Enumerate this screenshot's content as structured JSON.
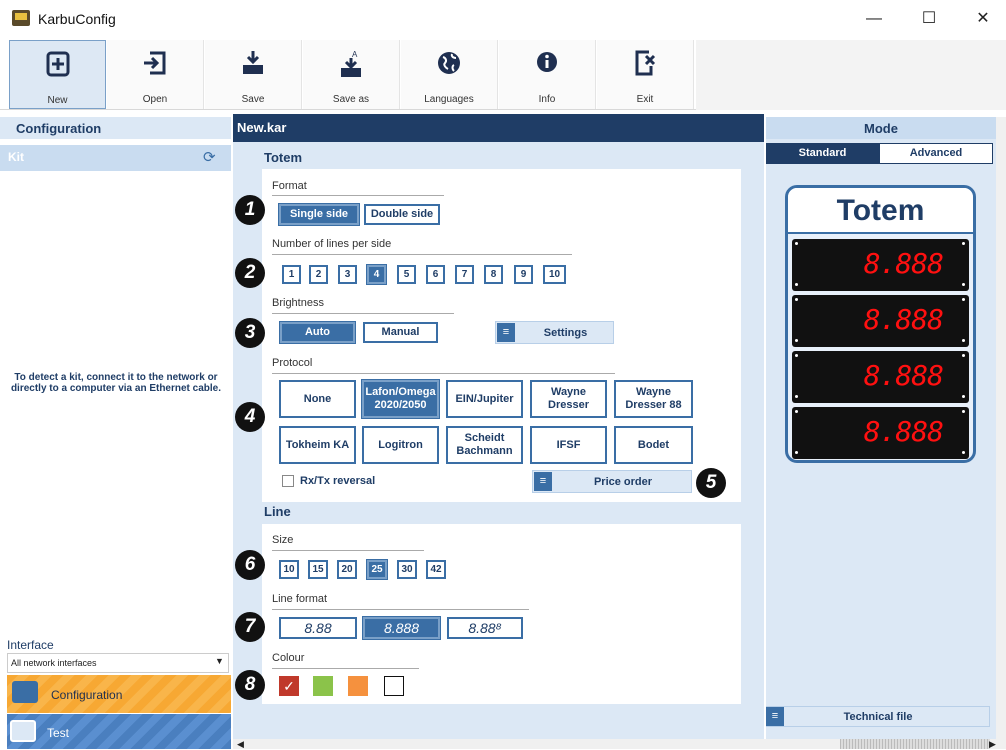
{
  "window": {
    "title": "KarbuConfig",
    "minimize": "—",
    "maximize": "☐",
    "close": "✕"
  },
  "toolbar": [
    {
      "label": "New",
      "icon": "new-icon"
    },
    {
      "label": "Open",
      "icon": "open-icon"
    },
    {
      "label": "Save",
      "icon": "save-icon"
    },
    {
      "label": "Save as",
      "icon": "save-as-icon"
    },
    {
      "label": "Languages",
      "icon": "globe-icon"
    },
    {
      "label": "Info",
      "icon": "info-icon"
    },
    {
      "label": "Exit",
      "icon": "exit-icon"
    }
  ],
  "left": {
    "configuration": "Configuration",
    "kit": "Kit",
    "kit_message": "To detect a kit, connect it to the network or directly to a computer via an Ethernet cable.",
    "interface_label": "Interface",
    "interface_value": "All network interfaces",
    "nav_configuration": "Configuration",
    "nav_test": "Test"
  },
  "center": {
    "document": "New.kar",
    "totem_section": "Totem",
    "format_label": "Format",
    "format_options": [
      "Single side",
      "Double side"
    ],
    "format_selected": "Single side",
    "lines_label": "Number of lines per side",
    "lines_options": [
      "1",
      "2",
      "3",
      "4",
      "5",
      "6",
      "7",
      "8",
      "9",
      "10"
    ],
    "lines_selected": "4",
    "brightness_label": "Brightness",
    "brightness_options": [
      "Auto",
      "Manual"
    ],
    "brightness_selected": "Auto",
    "settings_label": "Settings",
    "protocol_label": "Protocol",
    "protocol_options": [
      "None",
      "Lafon/Omega 2020/2050",
      "EIN/Jupiter",
      "Wayne Dresser",
      "Wayne Dresser 88",
      "Tokheim KA",
      "Logitron",
      "Scheidt Bachmann",
      "IFSF",
      "Bodet"
    ],
    "protocol_selected": "Lafon/Omega 2020/2050",
    "rxtx_label": "Rx/Tx reversal",
    "rxtx_checked": false,
    "price_order_label": "Price order",
    "line_section": "Line",
    "size_label": "Size",
    "size_options": [
      "10",
      "15",
      "20",
      "25",
      "30",
      "42"
    ],
    "size_selected": "25",
    "line_format_label": "Line format",
    "line_format_options": [
      "8.88",
      "8.888",
      "8.88⁸"
    ],
    "line_format_selected": "8.888",
    "colour_label": "Colour",
    "colours": [
      "#c0392b",
      "#8bc34a",
      "#f5913e",
      "#ffffff"
    ],
    "colour_selected": "#c0392b",
    "callouts": [
      "1",
      "2",
      "3",
      "4",
      "5",
      "6",
      "7",
      "8"
    ]
  },
  "right": {
    "mode": "Mode",
    "standard": "Standard",
    "advanced": "Advanced",
    "mode_selected": "Standard",
    "totem_title": "Totem",
    "displays": [
      "8.888",
      "8.888",
      "8.888",
      "8.888"
    ],
    "technical_file": "Technical file"
  }
}
